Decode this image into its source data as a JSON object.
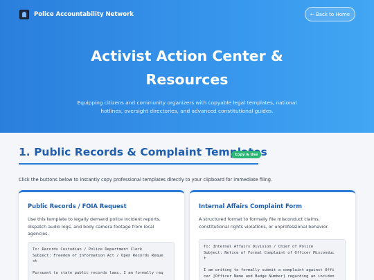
{
  "header": {
    "brand": "Police Accountability Network",
    "back_label": "← Back to Home"
  },
  "hero": {
    "title": "Activist Action Center & Resources",
    "subtitle": "Equipping citizens and community organizers with copyable legal templates, national hotlines, oversight directories, and advanced constitutional guides."
  },
  "section": {
    "title": "1. Public Records & Complaint Templates",
    "badge": "Copy & Use",
    "intro": "Click the buttons below to instantly copy professional templates directly to your clipboard for immediate filing."
  },
  "cards": [
    {
      "title": "Public Records / FOIA Request",
      "description": "Use this template to legally demand police incident reports, dispatch audio logs, and body camera footage from local agencies.",
      "template": "To: Records Custodian / Police Department Clerk\nSubject: Freedom of Information Act / Open Records Reque\nst\n\nPursuant to state public records laws, I am formally req"
    },
    {
      "title": "Internal Affairs Complaint Form",
      "description": "A structured format to formally file misconduct claims, constitutional rights violations, or unprofessional behavior.",
      "template": "To: Internal Affairs Division / Chief of Police\nSubject: Notice of Formal Complaint of Officer Misconduc\nt\n\nI am writing to formally submit a complaint against Offi\ncer [Officer Name and Badge Number] regarding an inciden"
    }
  ],
  "colors": {
    "accent": "#1f5fae",
    "badge": "#2bb673",
    "hero_start": "#2a7fdc",
    "hero_end": "#42a6f3"
  }
}
